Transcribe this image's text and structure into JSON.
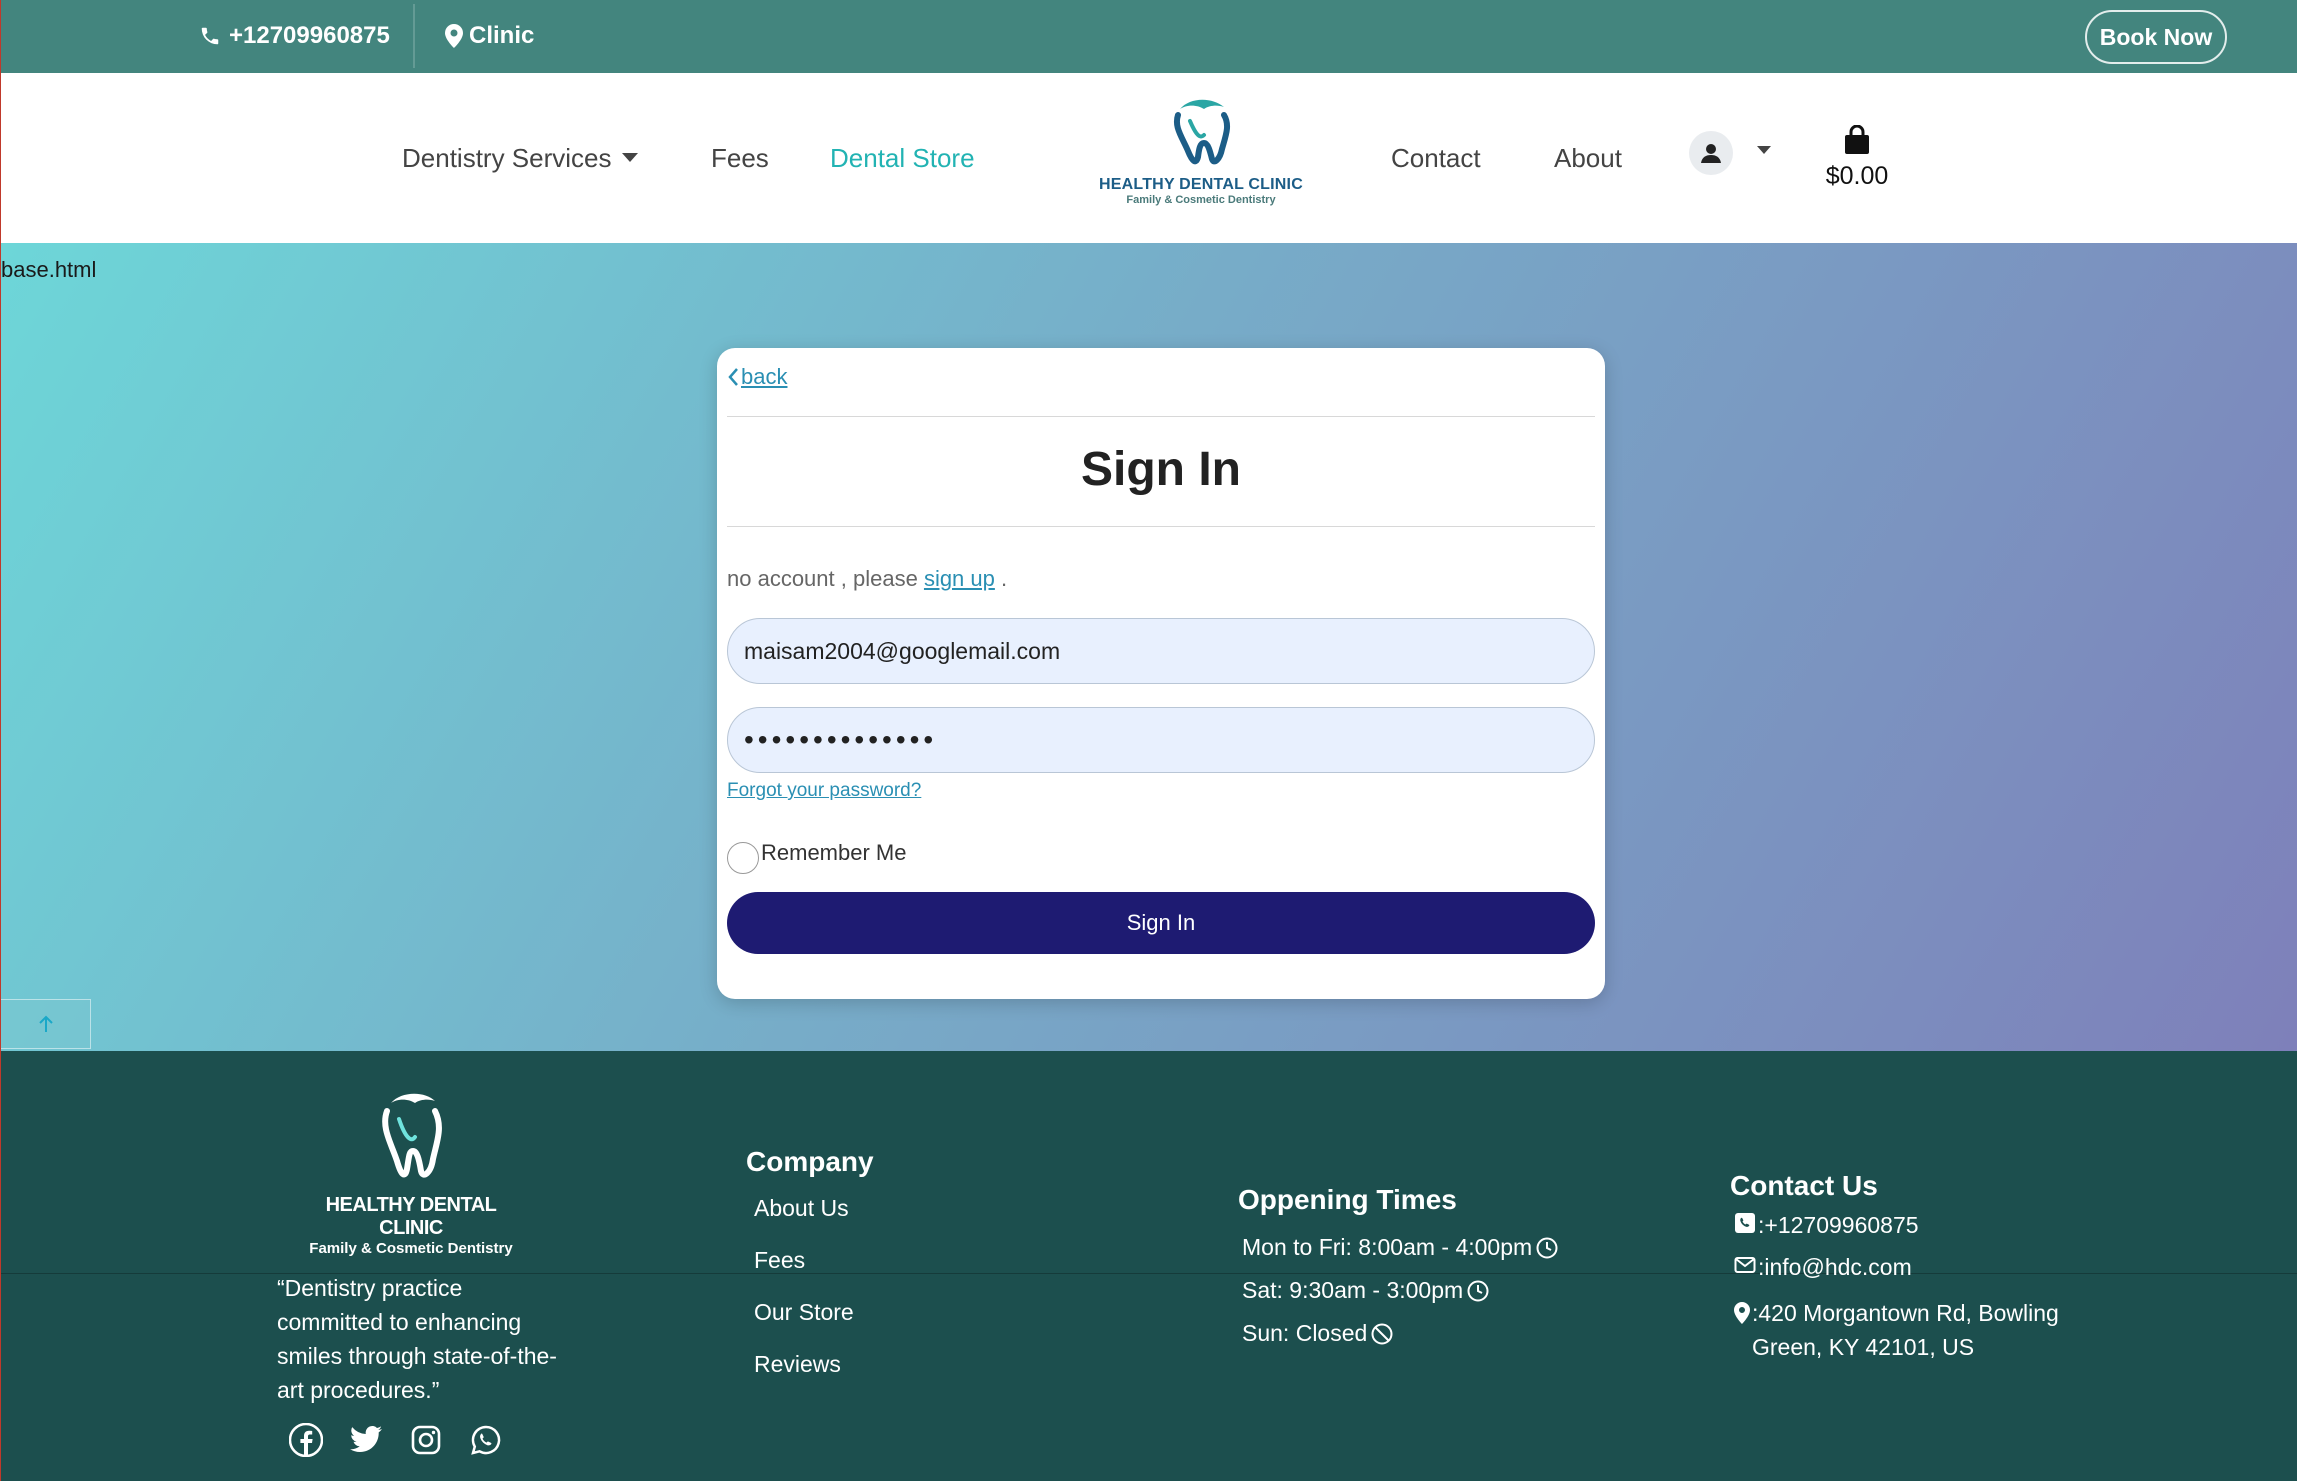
{
  "topbar": {
    "phone": "+12709960875",
    "clinic": "Clinic",
    "book_now": "Book Now"
  },
  "nav": {
    "dentistry_services": "Dentistry Services",
    "fees": "Fees",
    "dental_store": "Dental Store",
    "contact": "Contact",
    "about": "About",
    "cart_total": "$0.00"
  },
  "logo": {
    "title": "HEALTHY DENTAL CLINIC",
    "subtitle": "Family & Cosmetic Dentistry"
  },
  "page": {
    "base_label": "base.html"
  },
  "signin": {
    "back": "back",
    "title": "Sign In",
    "no_account_prefix": "no account , please",
    "sign_up": "sign up",
    "no_account_suffix": ".",
    "email_value": "maisam2004@googlemail.com",
    "password_mask": "••••••••••••••",
    "forgot": "Forgot your password?",
    "remember": "Remember Me",
    "submit": "Sign In"
  },
  "footer": {
    "logo_title": "HEALTHY DENTAL CLINIC",
    "logo_subtitle": "Family & Cosmetic Dentistry",
    "quote": "“Dentistry practice committed to enhancing smiles through state-of-the-art procedures.”",
    "company": {
      "heading": "Company",
      "links": [
        "About Us",
        "Fees",
        "Our Store",
        "Reviews"
      ]
    },
    "hours": {
      "heading": "Oppening Times",
      "rows": [
        "Mon to Fri: 8:00am - 4:00pm",
        "Sat: 9:30am - 3:00pm",
        "Sun: Closed"
      ]
    },
    "contact": {
      "heading": "Contact Us",
      "phone": ":+12709960875",
      "email": ":info@hdc.com",
      "address": ":420 Morgantown Rd, Bowling Green, KY 42101, US"
    },
    "socials": [
      "facebook-icon",
      "twitter-icon",
      "instagram-icon",
      "whatsapp-icon"
    ]
  },
  "colors": {
    "topbar": "#43857e",
    "accent": "#22b3b3",
    "button": "#1e1b72",
    "footer": "#1c4f4e"
  }
}
